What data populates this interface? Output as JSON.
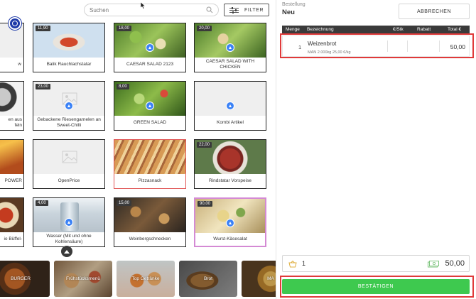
{
  "search": {
    "placeholder": "Suchen"
  },
  "filter": {
    "label": "FILTER"
  },
  "products": [
    {
      "name": "w",
      "price": ""
    },
    {
      "name": "Balik Rauchlachstatar",
      "price": "11,90"
    },
    {
      "name": "CAESAR SALAD 2123",
      "price": "18,00"
    },
    {
      "name": "CAESAR SALAD WITH CHICKEN",
      "price": "20,00"
    },
    {
      "name": "en aus\nfeln",
      "price": ""
    },
    {
      "name": "Gebackene Riesengarnelen an Sweet-Chilli",
      "price": "23,00"
    },
    {
      "name": "GREEN SALAD",
      "price": "8,00"
    },
    {
      "name": "Kombi Artikel",
      "price": ""
    },
    {
      "name": "POWER",
      "price": ""
    },
    {
      "name": "OpenPrice",
      "price": ""
    },
    {
      "name": "Pizzasnack",
      "price": ""
    },
    {
      "name": "Rindstatar Vorspeise",
      "price": "22,00"
    },
    {
      "name": "io Büffel-",
      "price": ""
    },
    {
      "name": "Wasser (Mit und ohne Kohlensäure)",
      "price": "4,00"
    },
    {
      "name": "Weinbergschnecken",
      "price": "15,00"
    },
    {
      "name": "Wurst-Käsesalat",
      "price": "90,00"
    }
  ],
  "categories": [
    {
      "name": "BURGER"
    },
    {
      "name": "Frühstücksmenü"
    },
    {
      "name": "Top Getränke"
    },
    {
      "name": "Brot"
    },
    {
      "name": "MA"
    }
  ],
  "order": {
    "label": "Bestellung",
    "title": "Neu",
    "cancel_label": "ABBRECHEN",
    "columns": [
      "Menge",
      "Bezeichnung",
      "€/Stk",
      "Rabatt",
      "Total €"
    ],
    "items": [
      {
        "qty": "1",
        "name": "Weizenbrot",
        "sub": "MAN 2.000kg  25,00 €/kg",
        "total": "50,00"
      }
    ],
    "summary_qty": "1",
    "summary_total": "50,00",
    "confirm_label": "BESTÄTIGEN"
  },
  "colors": {
    "confirm": "#3ec94f",
    "highlight": "#e03a3a",
    "header": "#3a3a3a"
  }
}
